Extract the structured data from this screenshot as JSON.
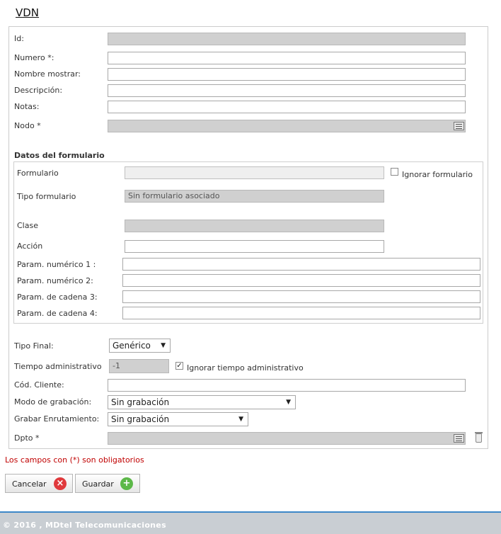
{
  "page": {
    "title": "VDN"
  },
  "form": {
    "id_label": "Id:",
    "numero_label": "Numero *:",
    "nombre_label": "Nombre mostrar:",
    "descripcion_label": "Descripción:",
    "notas_label": "Notas:",
    "nodo_label": "Nodo *"
  },
  "datos": {
    "title": "Datos del formulario",
    "formulario_label": "Formulario",
    "ignorar_formulario_label": "Ignorar formulario",
    "ignorar_formulario_checked": false,
    "tipo_formulario_label": "Tipo formulario",
    "tipo_formulario_value": "Sin formulario asociado",
    "clase_label": "Clase",
    "accion_label": "Acción",
    "param_num1_label": "Param. numérico 1 :",
    "param_num2_label": "Param. numérico 2:",
    "param_cad3_label": "Param. de cadena 3:",
    "param_cad4_label": "Param. de cadena 4:"
  },
  "extra": {
    "tipo_final_label": "Tipo Final:",
    "tipo_final_value": "Genérico",
    "tiempo_admin_label": "Tiempo administrativo",
    "tiempo_admin_value": "-1",
    "ignorar_tiempo_label": "Ignorar tiempo administrativo",
    "ignorar_tiempo_checked": true,
    "cod_cliente_label": "Cód. Cliente:",
    "modo_grabacion_label": "Modo de grabación:",
    "modo_grabacion_value": "Sin grabación",
    "grabar_enrutamiento_label": "Grabar Enrutamiento:",
    "grabar_enrutamiento_value": "Sin grabación",
    "dpto_label": "Dpto *"
  },
  "required_note": "Los campos con (*) son obligatorios",
  "buttons": {
    "cancel_label": "Cancelar",
    "save_label": "Guardar",
    "cancel_icon": "x-circle-icon",
    "save_icon": "plus-circle-icon",
    "cancel_color": "#e0393c",
    "save_color": "#5cb848"
  },
  "footer": {
    "text": "© 2016 , MDtel Telecomunicaciones"
  }
}
